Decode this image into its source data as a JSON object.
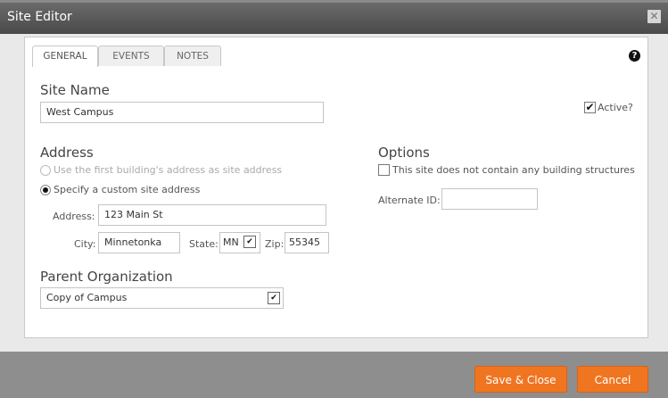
{
  "window": {
    "title": "Site Editor",
    "close_glyph": "✕"
  },
  "tabs": [
    {
      "label": "GENERAL",
      "active": true
    },
    {
      "label": "EVENTS",
      "active": false
    },
    {
      "label": "NOTES",
      "active": false
    }
  ],
  "help_icon": {
    "icon": "help-icon",
    "glyph": "?"
  },
  "site_name": {
    "heading": "Site Name",
    "value": "West Campus"
  },
  "active_checkbox": {
    "label": "Active?",
    "checked": true,
    "glyph": "✔"
  },
  "address": {
    "heading": "Address",
    "radio_first_building": "Use the first building's address as site address",
    "radio_custom": "Specify a custom site address",
    "address_label": "Address:",
    "address_value": "123 Main St",
    "city_label": "City:",
    "city_value": "Minnetonka",
    "state_label": "State:",
    "state_value": "MN",
    "zip_label": "Zip:",
    "zip_value": "55345"
  },
  "options": {
    "heading": "Options",
    "no_structures_label": "This site does not contain any building structures",
    "no_structures_checked": false,
    "alternate_id_label": "Alternate ID:",
    "alternate_id_value": ""
  },
  "parent_org": {
    "heading": "Parent Organization",
    "selected": "Copy of Campus"
  },
  "dropdown_glyph": "✔",
  "buttons": {
    "save_close": "Save & Close",
    "cancel": "Cancel"
  },
  "colors": {
    "accent": "#f07521",
    "titlebar": "#555555",
    "footer": "#8e8e8e"
  }
}
